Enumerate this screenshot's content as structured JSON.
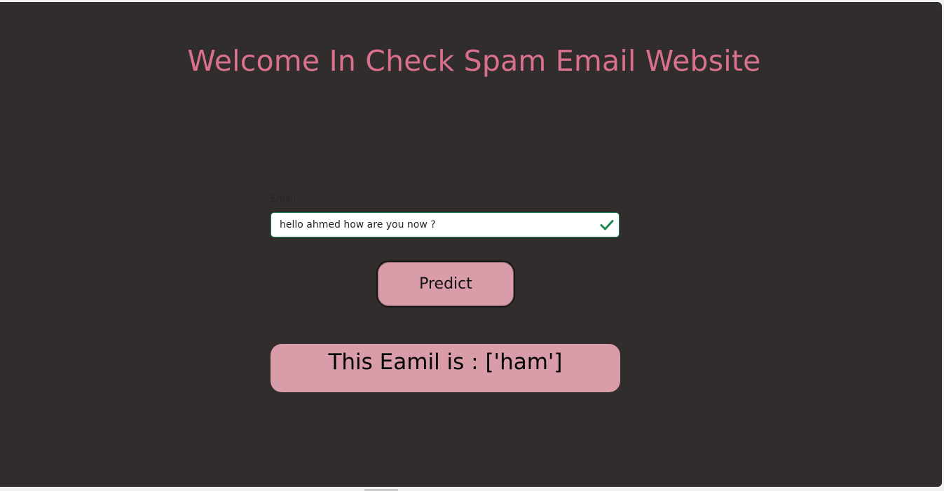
{
  "page": {
    "title": "Welcome In Check Spam Email Website"
  },
  "form": {
    "email_label": "Email",
    "email_value": "hello ahmed how are you now ?",
    "valid_icon": "checkmark-icon",
    "predict_label": "Predict"
  },
  "result": {
    "text": "This Eamil is : ['ham']"
  },
  "colors": {
    "background": "#322d2d",
    "title": "#d9708f",
    "label": "#2a2525",
    "button": "#d99ca9",
    "result_box": "#d99ca9",
    "valid": "#198754"
  }
}
